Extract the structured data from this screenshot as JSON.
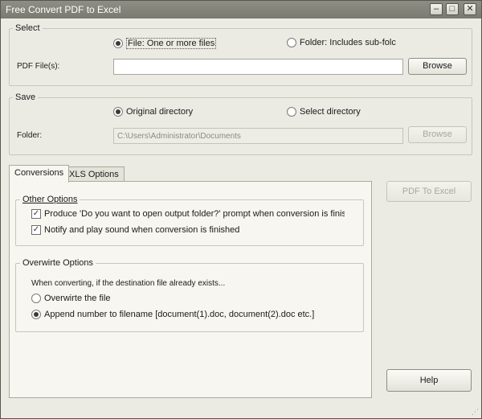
{
  "window": {
    "title": "Free Convert PDF to Excel",
    "controls": {
      "minimize": "–",
      "maximize": "□",
      "close": "✕"
    }
  },
  "select_group": {
    "title": "Select",
    "radio_file": "File:  One or more files",
    "radio_folder": "Folder: Includes sub-folc",
    "pdf_label": "PDF File(s):",
    "pdf_value": "",
    "browse_label": "Browse"
  },
  "save_group": {
    "title": "Save",
    "radio_original": "Original directory",
    "radio_select": "Select directory",
    "folder_label": "Folder:",
    "folder_value": "C:\\Users\\Administrator\\Documents",
    "browse_label": "Browse"
  },
  "tabs": [
    {
      "label": "Conversions"
    },
    {
      "label": "XLS Options"
    }
  ],
  "other_options": {
    "title": "Other Options",
    "prompt_option": "Produce 'Do you want to open output folder?' prompt when conversion is finis",
    "notify_option": "Notify and play sound when conversion is finished"
  },
  "overwrite_options": {
    "title": "Overwirte Options",
    "description": "When converting, if the destination file already exists...",
    "overwrite": "Overwirte the file",
    "append": "Append number to filename  [document(1).doc, document(2).doc etc.]"
  },
  "buttons": {
    "convert": "PDF To Excel",
    "help": "Help"
  },
  "colors": {
    "window_bg": "#ecebe3",
    "titlebar": "#858579",
    "border": "#c7c7bd"
  }
}
